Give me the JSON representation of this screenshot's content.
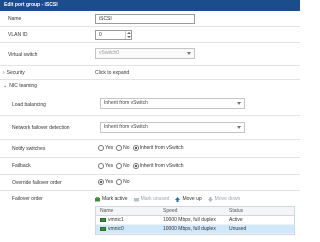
{
  "window": {
    "title": "Edit port group - iSCSI"
  },
  "fields": {
    "name": {
      "label": "Name",
      "value": "iSCSI"
    },
    "vlan": {
      "label": "VLAN ID",
      "value": "0"
    },
    "vswitch": {
      "label": "Virtual switch",
      "value": "vSwitch0"
    }
  },
  "security": {
    "label": "Security",
    "value": "Click to expand"
  },
  "nic_teaming": {
    "label": "NIC teaming",
    "load_balancing": {
      "label": "Load balancing",
      "value": "Inherit from vSwitch"
    },
    "failover_detection": {
      "label": "Network failover detection",
      "value": "Inherit from vSwitch"
    },
    "notify_switches": {
      "label": "Notify switches",
      "options": [
        "Yes",
        "No",
        "Inherit from vSwitch"
      ],
      "selected": "Inherit from vSwitch"
    },
    "failback": {
      "label": "Failback",
      "options": [
        "Yes",
        "No",
        "Inherit from vSwitch"
      ],
      "selected": "Inherit from vSwitch"
    },
    "override_failover": {
      "label": "Override failover order",
      "options": [
        "Yes",
        "No"
      ],
      "selected": "Yes"
    },
    "failover_order": {
      "label": "Failover order",
      "toolbar": {
        "mark_active": "Mark active",
        "mark_unused": "Mark unused",
        "move_up": "Move up",
        "move_down": "Move down"
      },
      "columns": [
        "Name",
        "Speed",
        "Status"
      ],
      "rows": [
        {
          "name": "vmnic1",
          "speed": "10000 Mbps, full duplex",
          "status": "Active",
          "selected": false
        },
        {
          "name": "vmnic0",
          "speed": "10000 Mbps, full duplex",
          "status": "Unused",
          "selected": true
        }
      ]
    }
  },
  "colors": {
    "titlebar": "#1b4d8c",
    "selected_row": "#cfe8fb",
    "nic_icon": "#3b8a3e"
  }
}
